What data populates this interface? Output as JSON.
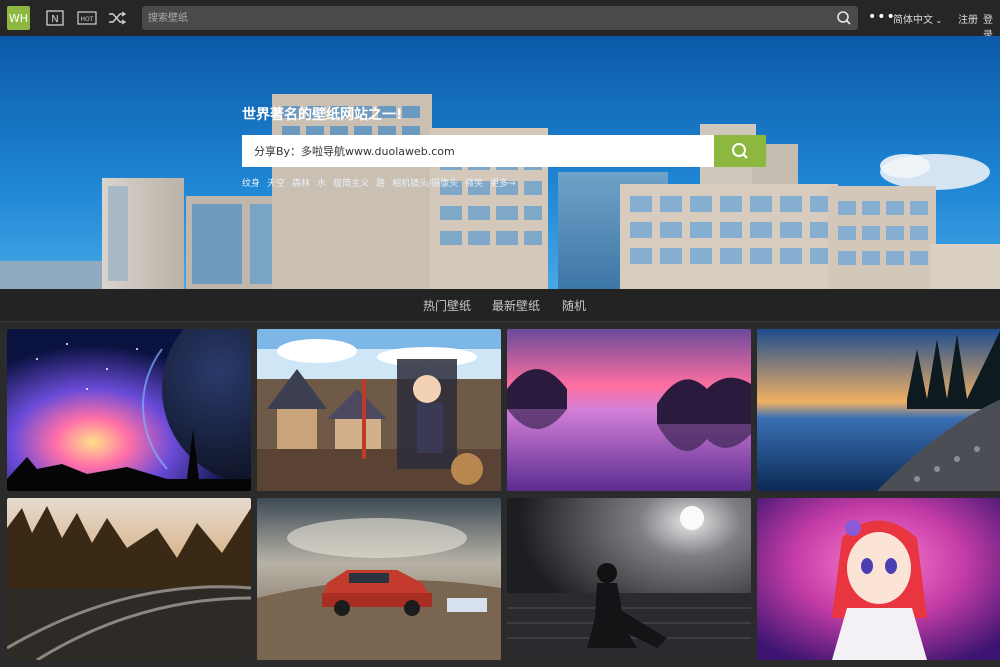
{
  "logo": {
    "text": "WH"
  },
  "nav": {
    "icons": [
      "new-icon",
      "hot-icon",
      "shuffle-icon"
    ],
    "new_label": "N",
    "hot_label": "HOT",
    "search_placeholder": "搜索壁纸",
    "more": "•••",
    "language": "简体中文",
    "register": "注册",
    "login": "登录"
  },
  "hero": {
    "title": "世界著名的壁纸网站之一!",
    "search_value": "分享By：多啦导航www.duolaweb.com",
    "tags": [
      "纹身",
      "天空",
      "森林",
      "水",
      "极简主义",
      "路",
      "相机镜头/摄像头",
      "微笑",
      "更多→"
    ]
  },
  "tabs": [
    "热门壁纸",
    "最新壁纸",
    "随机"
  ],
  "colors": {
    "accent": "#8cb83f",
    "topbar": "#262626",
    "background": "#2b2b2b"
  },
  "thumbnails": [
    {
      "subject": "galaxy-planet"
    },
    {
      "subject": "anime-castle-town"
    },
    {
      "subject": "purple-lake-sunset"
    },
    {
      "subject": "blue-shore-sunset"
    },
    {
      "subject": "railway-forest-autumn"
    },
    {
      "subject": "red-car-landscape"
    },
    {
      "subject": "catwoman-dark"
    },
    {
      "subject": "anime-girl-pink"
    }
  ]
}
